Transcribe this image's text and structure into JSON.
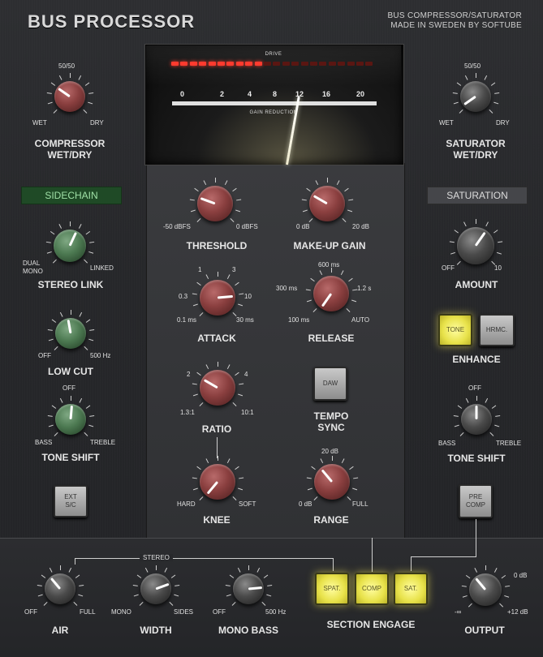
{
  "header": {
    "title": "BUS PROCESSOR",
    "subtitle_line1": "BUS COMPRESSOR/SATURATOR",
    "subtitle_line2": "MADE IN SWEDEN BY SOFTUBE"
  },
  "meter": {
    "drive_label": "DRIVE",
    "gain_reduction_label": "GAIN REDUCTION",
    "scale": [
      "0",
      "2",
      "4",
      "8",
      "12",
      "16",
      "20"
    ],
    "drive_leds_lit": 10,
    "drive_leds_total": 22,
    "needle_value": 11
  },
  "compressor_wet_dry": {
    "top_label": "50/50",
    "left_label": "WET",
    "right_label": "DRY",
    "name_line1": "COMPRESSOR",
    "name_line2": "WET/DRY"
  },
  "saturator_wet_dry": {
    "top_label": "50/50",
    "left_label": "WET",
    "right_label": "DRY",
    "name_line1": "SATURATOR",
    "name_line2": "WET/DRY"
  },
  "sidechain": {
    "header": "SIDECHAIN",
    "stereo_link": {
      "left_label_1": "DUAL",
      "left_label_2": "MONO",
      "right_label": "LINKED",
      "name": "STEREO LINK"
    },
    "low_cut": {
      "left_label": "OFF",
      "right_label": "500 Hz",
      "name": "LOW CUT"
    },
    "tone_shift": {
      "top_label": "OFF",
      "left_label": "BASS",
      "right_label": "TREBLE",
      "name": "TONE SHIFT"
    },
    "ext_sc_button": {
      "line1": "EXT",
      "line2": "S/C"
    }
  },
  "compressor": {
    "threshold": {
      "left_label": "-50 dBFS",
      "right_label": "0 dBFS",
      "name": "THRESHOLD"
    },
    "makeup_gain": {
      "left_label": "0 dB",
      "right_label": "20 dB",
      "name": "MAKE-UP GAIN"
    },
    "attack": {
      "l1": "1",
      "l3": "3",
      "l03": "0.3",
      "l10": "10",
      "l01": "0.1 ms",
      "l30": "30 ms",
      "name": "ATTACK"
    },
    "release": {
      "top": "600 ms",
      "l300": "300 ms",
      "l12": "1.2 s",
      "l100": "100 ms",
      "auto": "AUTO",
      "name": "RELEASE"
    },
    "ratio": {
      "l2": "2",
      "l4": "4",
      "l13": "1.3:1",
      "l10": "10:1",
      "name": "RATIO"
    },
    "tempo_sync": {
      "button": "DAW",
      "name_line1": "TEMPO",
      "name_line2": "SYNC"
    },
    "knee": {
      "left_label": "HARD",
      "right_label": "SOFT",
      "name": "KNEE"
    },
    "range": {
      "top": "20 dB",
      "left_label": "0 dB",
      "right_label": "FULL",
      "name": "RANGE"
    }
  },
  "saturation": {
    "header": "SATURATION",
    "amount": {
      "left_label": "OFF",
      "right_label": "10",
      "name": "AMOUNT"
    },
    "enhance": {
      "tone": "TONE",
      "hrmc": "HRMC.",
      "name": "ENHANCE"
    },
    "tone_shift": {
      "top_label": "OFF",
      "left_label": "BASS",
      "right_label": "TREBLE",
      "name": "TONE SHIFT"
    },
    "pre_comp": {
      "line1": "PRE",
      "line2": "COMP"
    }
  },
  "bottom": {
    "stereo_label": "STEREO",
    "air": {
      "left_label": "OFF",
      "right_label": "FULL",
      "name": "AIR"
    },
    "width": {
      "left_label": "MONO",
      "right_label": "SIDES",
      "name": "WIDTH"
    },
    "mono_bass": {
      "left_label": "OFF",
      "right_label": "500 Hz",
      "name": "MONO BASS"
    },
    "section_engage": {
      "spat": "SPAT.",
      "comp": "COMP",
      "sat": "SAT.",
      "name": "SECTION ENGAGE"
    },
    "output": {
      "top": "0 dB",
      "left_label": "-∞",
      "right_label": "+12 dB",
      "name": "OUTPUT"
    }
  },
  "colors": {
    "led_on": "#ff3b2f",
    "led_off": "#5a1612",
    "knob_red": "#8a3f3f",
    "knob_green": "#4d7a52",
    "knob_gray": "#4a4a4a",
    "button_active": "#e8e24a",
    "sidechain_header": "#1f4a26"
  },
  "knob_angles": {
    "comp_wetdry": -55,
    "sat_wetdry": -125,
    "stereo_link": 25,
    "low_cut": -10,
    "sc_tone_shift": 5,
    "threshold": -70,
    "makeup_gain": -60,
    "attack": 85,
    "release": -145,
    "ratio": -60,
    "knee": -140,
    "range": -40,
    "amount": 35,
    "sat_tone_shift": 0,
    "air": -40,
    "width": 70,
    "mono_bass": 85,
    "output": -40
  }
}
